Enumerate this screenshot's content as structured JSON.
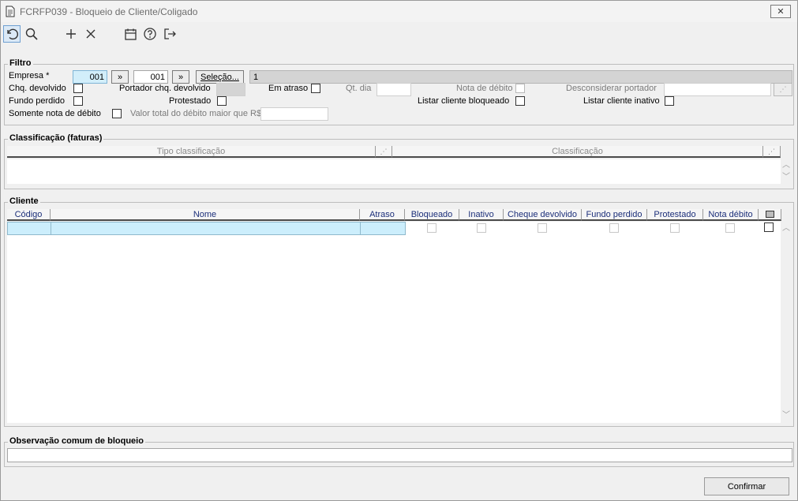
{
  "window": {
    "title": "FCRFP039 - Bloqueio de Cliente/Coligado",
    "close_symbol": "✕",
    "app_icon": "document-icon"
  },
  "toolbar": {
    "icons": [
      "undo-icon",
      "search-icon",
      "add-icon",
      "delete-icon",
      "calendar-icon",
      "help-icon",
      "exit-icon"
    ]
  },
  "filtro": {
    "legend": "Filtro",
    "empresa_label": "Empresa *",
    "empresa_from": "001",
    "range_btn": "»",
    "empresa_to": "001",
    "range_btn2": "»",
    "selecao_btn": "Seleção...",
    "selecao_value": "1",
    "chq_devolvido": "Chq. devolvido",
    "portador_chq": "Portador chq. devolvido",
    "em_atraso": "Em atraso",
    "qt_dia": "Qt. dia",
    "nota_debito": "Nota de débito",
    "desconsiderar_portador": "Desconsiderar portador",
    "fundo_perdido": "Fundo perdido",
    "protestado": "Protestado",
    "listar_bloqueado": "Listar cliente bloqueado",
    "listar_inativo": "Listar cliente inativo",
    "somente_nota": "Somente nota de débito",
    "valor_total": "Valor total do débito maior que R$"
  },
  "classificacao": {
    "legend": "Classificação (faturas)",
    "col_tipo": "Tipo classificação",
    "col_class": "Classificação"
  },
  "cliente": {
    "legend": "Cliente",
    "columns": [
      "Código",
      "Nome",
      "Atraso",
      "Bloqueado",
      "Inativo",
      "Cheque devolvido",
      "Fundo perdido",
      "Protestado",
      "Nota débito"
    ]
  },
  "observacao": {
    "legend": "Observação comum de bloqueio",
    "value": ""
  },
  "footer": {
    "confirm": "Confirmar"
  }
}
